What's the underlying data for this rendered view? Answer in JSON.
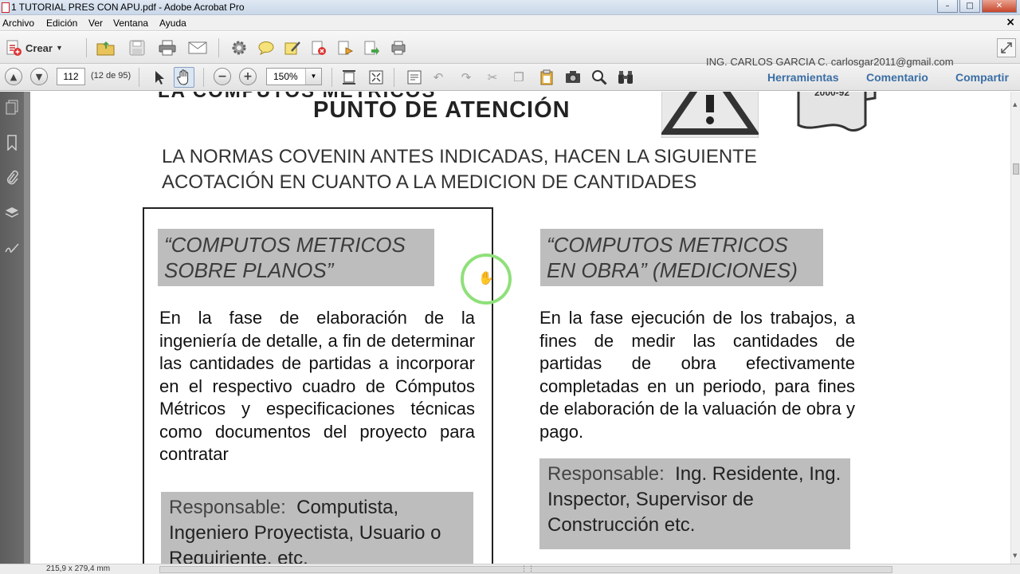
{
  "window": {
    "title": "1 TUTORIAL PRES CON APU.pdf - Adobe Acrobat Pro",
    "minimize_glyph": "–",
    "maximize_glyph": "□",
    "close_glyph": "✕"
  },
  "menubar": {
    "items": [
      "Archivo",
      "Edición",
      "Ver",
      "Ventana",
      "Ayuda"
    ],
    "close_glyph": "×"
  },
  "toolbar": {
    "crear_label": "Crear",
    "icons": [
      "open-folder-icon",
      "save-icon",
      "print-icon",
      "email-icon",
      "settings-icon",
      "comment-icon",
      "sticky-note-icon",
      "secure-icon",
      "sign-icon",
      "export-icon",
      "combine-icon"
    ]
  },
  "nav": {
    "page_number": "112",
    "page_count": "(12 de 95)",
    "zoom": "150%",
    "author_watermark": "ING. CARLOS GARCIA C. carlosgar2011@gmail.com",
    "right_links": [
      "Herramientas",
      "Comentario",
      "Compartir"
    ]
  },
  "status": {
    "page_dimensions": "215,9 x 279,4 mm"
  },
  "document": {
    "cutoff_title": "LA COMPUTOS METRICOS",
    "heading": "PUNTO DE ATENCIÓN",
    "subhead_line1": "LA NORMAS COVENIN  ANTES INDICADAS, HACEN LA SIGUIENTE",
    "subhead_line2": "ACOTACIÓN  EN  CUANTO  A  LA  MEDICION DE CANTIDADES",
    "norm_doc_label": "2000-92",
    "left": {
      "title_line1": "“COMPUTOS METRICOS",
      "title_line2": "SOBRE PLANOS”",
      "body": "En la fase de elaboración de la ingeniería de detalle, a fin de determinar las cantidades de partidas a incorporar en el respectivo cuadro de Cómputos Métricos y especificaciones técnicas como documentos del proyecto para contratar",
      "resp_label": "Responsable:",
      "resp_text": "Computista, Ingeniero Proyectista, Usuario o Requiriente, etc."
    },
    "right": {
      "title_line1": "“COMPUTOS METRICOS",
      "title_line2": "EN OBRA”  (MEDICIONES)",
      "body": "En la fase ejecución de los trabajos, a fines de medir las cantidades de partidas de obra efectivamente completadas en un periodo, para fines de elaboración de la valuación de obra  y pago.",
      "resp_label": "Responsable:",
      "resp_text": "Ing. Residente, Ing. Inspector, Supervisor de Construcción etc."
    }
  }
}
